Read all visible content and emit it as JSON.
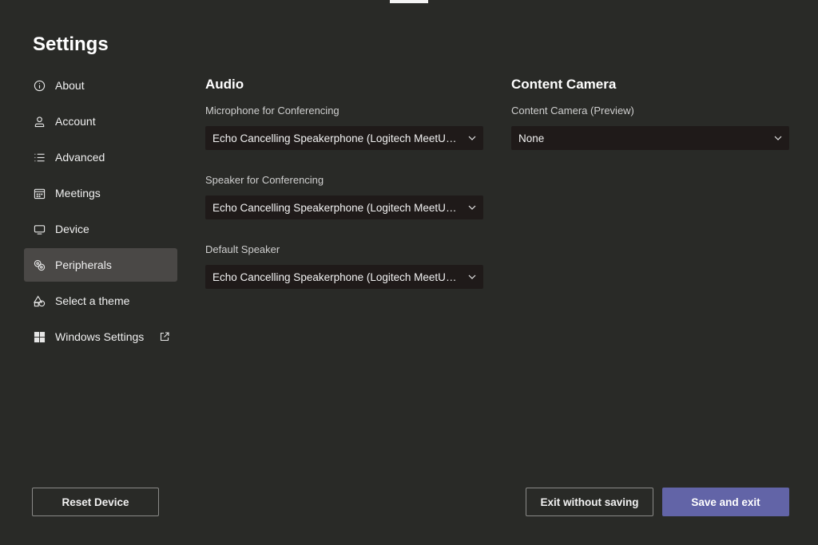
{
  "page": {
    "title": "Settings"
  },
  "sidebar": {
    "items": [
      {
        "label": "About",
        "icon": "info-icon"
      },
      {
        "label": "Account",
        "icon": "person-icon"
      },
      {
        "label": "Advanced",
        "icon": "list-icon"
      },
      {
        "label": "Meetings",
        "icon": "calendar-icon"
      },
      {
        "label": "Device",
        "icon": "monitor-icon"
      },
      {
        "label": "Peripherals",
        "icon": "peripherals-icon",
        "active": true
      },
      {
        "label": "Select a theme",
        "icon": "shapes-icon"
      },
      {
        "label": "Windows Settings",
        "icon": "windows-icon",
        "external": "external-link-icon"
      }
    ]
  },
  "audio": {
    "heading": "Audio",
    "microphone": {
      "label": "Microphone for Conferencing",
      "value": "Echo Cancelling Speakerphone (Logitech MeetUp Speakerphone)"
    },
    "speaker": {
      "label": "Speaker for Conferencing",
      "value": "Echo Cancelling Speakerphone (Logitech MeetUp Speakerphone)"
    },
    "default_speaker": {
      "label": "Default Speaker",
      "value": "Echo Cancelling Speakerphone (Logitech MeetUp Speakerphone)"
    }
  },
  "content_camera": {
    "heading": "Content Camera",
    "camera": {
      "label": "Content Camera (Preview)",
      "value": "None"
    }
  },
  "footer": {
    "reset_label": "Reset Device",
    "exit_label": "Exit without saving",
    "save_label": "Save and exit"
  },
  "colors": {
    "background": "#292a27",
    "active_nav": "#4a4846",
    "dropdown": "#1f1a19",
    "primary": "#6264a7"
  }
}
